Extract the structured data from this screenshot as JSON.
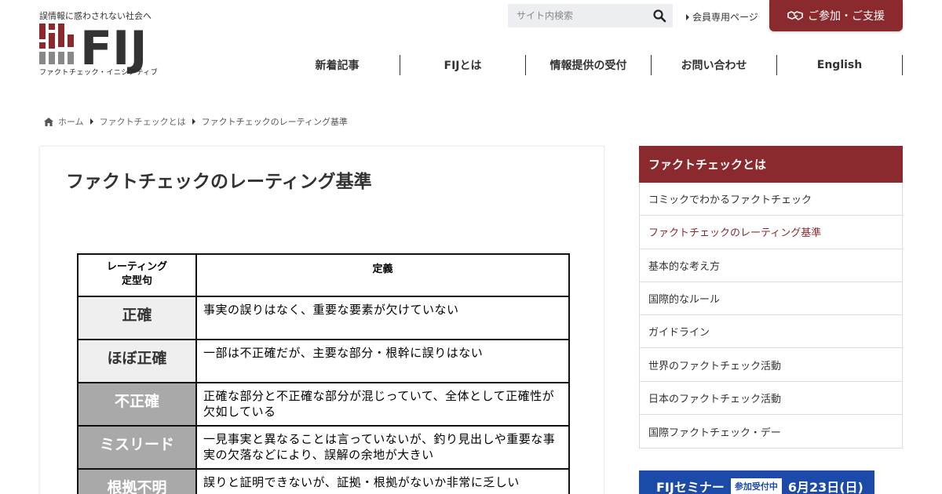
{
  "header": {
    "tagline": "誤情報に惑わされない社会へ",
    "logo_text": "FIJ",
    "logo_sub": "ファクトチェック・イニシアティブ",
    "search": {
      "placeholder": "サイト内検索"
    },
    "member_link": "会員専用ページ",
    "join_button": "ご参加・ご支援",
    "brand_color": "#8b2a2e"
  },
  "nav": {
    "items": [
      {
        "label": "新着記事"
      },
      {
        "label": "FIJとは"
      },
      {
        "label": "情報提供の受付"
      },
      {
        "label": "お問い合わせ"
      },
      {
        "label": "English"
      }
    ]
  },
  "breadcrumb": {
    "home": "ホーム",
    "level1": "ファクトチェックとは",
    "current": "ファクトチェックのレーティング基準"
  },
  "main": {
    "title": "ファクトチェックのレーティング基準",
    "table": {
      "headers": [
        "レーティング\n定型句",
        "定義"
      ],
      "rows": [
        {
          "term": "正確",
          "definition": "事実の誤りはなく、重要な要素が欠けていない",
          "style": "light"
        },
        {
          "term": "ほぼ正確",
          "definition": "一部は不正確だが、主要な部分・根幹に誤りはない",
          "style": "light"
        },
        {
          "term": "不正確",
          "definition": "正確な部分と不正確な部分が混じっていて、全体として正確性が欠如している",
          "style": "dark"
        },
        {
          "term": "ミスリード",
          "definition": "一見事実と異なることは言っていないが、釣り見出しや重要な事実の欠落などにより、誤解の余地が大きい",
          "style": "dark"
        },
        {
          "term": "根拠不明",
          "definition": "誤りと証明できないが、証拠・根拠がないか非常に乏しい",
          "style": "dark"
        }
      ]
    }
  },
  "sidebar": {
    "heading": "ファクトチェックとは",
    "items": [
      {
        "label": "コミックでわかるファクトチェック",
        "active": false
      },
      {
        "label": "ファクトチェックのレーティング基準",
        "active": true
      },
      {
        "label": "基本的な考え方",
        "active": false
      },
      {
        "label": "国際的なルール",
        "active": false
      },
      {
        "label": "ガイドライン",
        "active": false
      },
      {
        "label": "世界のファクトチェック活動",
        "active": false
      },
      {
        "label": "日本のファクトチェック活動",
        "active": false
      },
      {
        "label": "国際ファクトチェック・デー",
        "active": false
      }
    ]
  },
  "banner": {
    "title": "FIJセミナー",
    "badge": "参加受付中",
    "date": "6月23日(日)"
  }
}
